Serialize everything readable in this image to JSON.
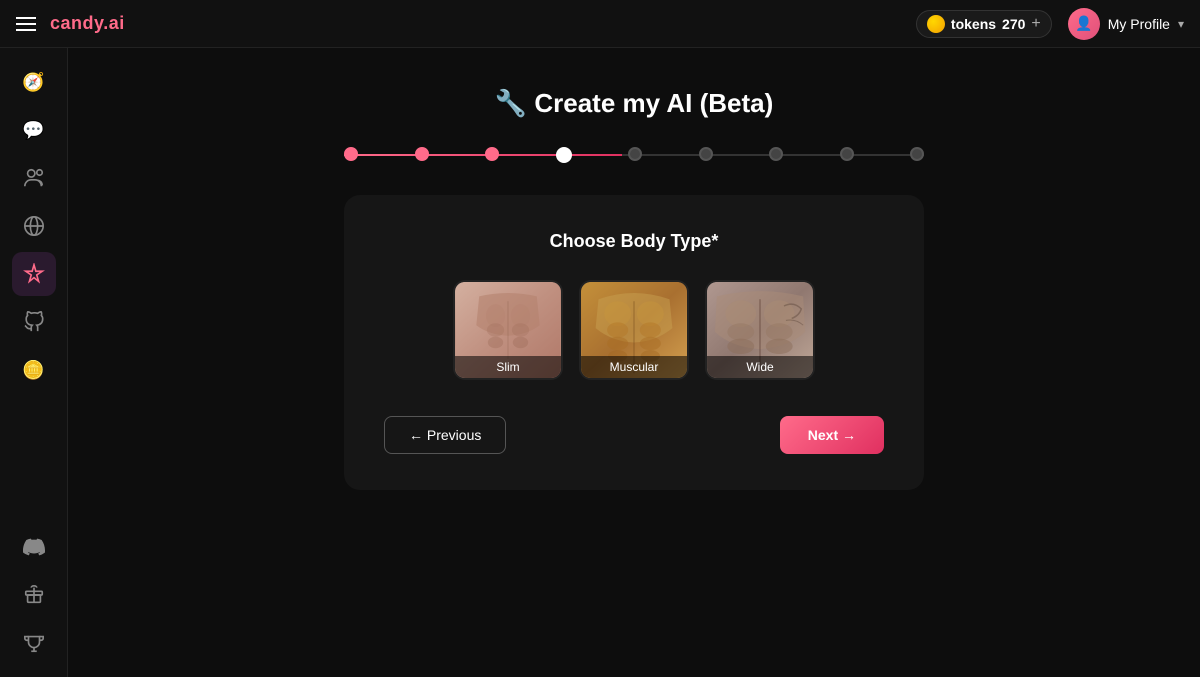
{
  "brand": {
    "name": "candy",
    "tld": ".ai",
    "logo_color": "#ff6b8a"
  },
  "header": {
    "tokens_label": "tokens",
    "tokens_count": "270",
    "add_icon": "+",
    "profile_name": "My Profile"
  },
  "sidebar": {
    "top_items": [
      {
        "id": "compass",
        "icon": "🧭",
        "label": "Explore",
        "active": false
      },
      {
        "id": "chat",
        "icon": "💬",
        "label": "Chat",
        "active": false
      },
      {
        "id": "personas",
        "icon": "👥",
        "label": "Personas",
        "active": false
      },
      {
        "id": "social",
        "icon": "🌐",
        "label": "Social",
        "active": false
      },
      {
        "id": "create",
        "icon": "✨",
        "label": "Create AI",
        "active": true
      }
    ],
    "middle_items": [
      {
        "id": "github",
        "icon": "⭕",
        "label": "GitHub",
        "active": false
      }
    ],
    "bottom_items": [
      {
        "id": "coin",
        "icon": "🪙",
        "label": "Tokens",
        "active": false
      }
    ],
    "footer_items": [
      {
        "id": "discord",
        "icon": "💬",
        "label": "Discord",
        "active": false
      },
      {
        "id": "gift",
        "icon": "🎁",
        "label": "Gift",
        "active": false
      },
      {
        "id": "trophy",
        "icon": "🏆",
        "label": "Trophy",
        "active": false
      }
    ]
  },
  "page": {
    "title": "🔧 Create my AI (Beta)",
    "stepper": {
      "total_steps": 9,
      "completed_steps": 3,
      "active_step": 4
    },
    "card": {
      "title": "Choose Body Type*",
      "body_types": [
        {
          "id": "slim",
          "label": "Slim",
          "selected": false
        },
        {
          "id": "muscular",
          "label": "Muscular",
          "selected": false
        },
        {
          "id": "wide",
          "label": "Wide",
          "selected": false
        }
      ],
      "btn_previous": "← Previous",
      "btn_next": "Next →"
    }
  }
}
